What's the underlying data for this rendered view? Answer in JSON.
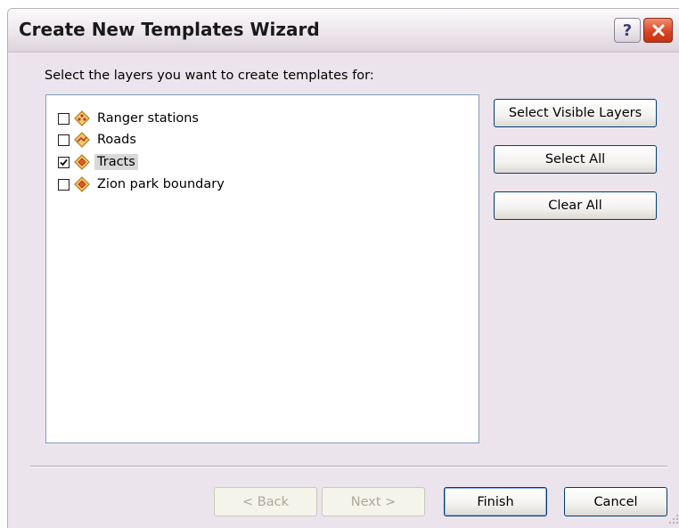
{
  "window": {
    "title": "Create New Templates Wizard",
    "help_label": "?",
    "close_icon": "close-x-icon"
  },
  "instruction": "Select the layers you want to create templates for:",
  "layers": [
    {
      "label": "Ranger stations",
      "checked": false,
      "selected": false,
      "icon": "point-layer-icon"
    },
    {
      "label": "Roads",
      "checked": false,
      "selected": false,
      "icon": "line-layer-icon"
    },
    {
      "label": "Tracts",
      "checked": true,
      "selected": true,
      "icon": "polygon-layer-icon"
    },
    {
      "label": "Zion park boundary",
      "checked": false,
      "selected": false,
      "icon": "polygon-layer-icon"
    }
  ],
  "side_buttons": {
    "select_visible": "Select Visible Layers",
    "select_all": "Select All",
    "clear_all": "Clear All"
  },
  "footer": {
    "back": "< Back",
    "next": "Next >",
    "finish": "Finish",
    "cancel": "Cancel"
  },
  "colors": {
    "dialog_bg": "#ece4ec",
    "button_border": "#003c74",
    "close_button": "#d84020",
    "selection_bg": "#d8d8d8"
  }
}
